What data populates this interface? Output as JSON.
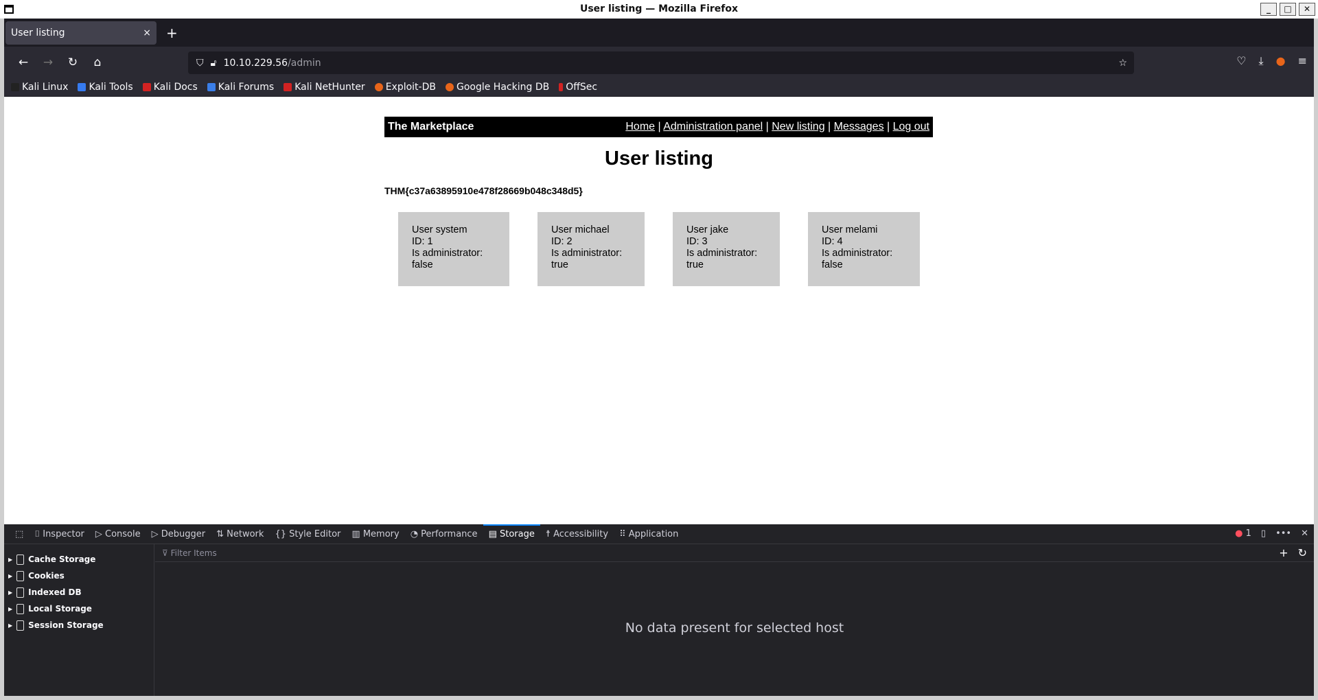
{
  "window": {
    "title": "User listing — Mozilla Firefox"
  },
  "tab": {
    "label": "User listing",
    "close": "×",
    "new": "+"
  },
  "url": {
    "host": "10.10.229.56",
    "path": "/admin"
  },
  "bookmarks": [
    {
      "label": "Kali Linux",
      "color": "#222222"
    },
    {
      "label": "Kali Tools",
      "color": "#367bf0"
    },
    {
      "label": "Kali Docs",
      "color": "#d22222"
    },
    {
      "label": "Kali Forums",
      "color": "#3a7ee8"
    },
    {
      "label": "Kali NetHunter",
      "color": "#d22222"
    },
    {
      "label": "Exploit-DB",
      "color": "#e8651a"
    },
    {
      "label": "Google Hacking DB",
      "color": "#e8651a"
    },
    {
      "label": "OffSec",
      "color": "#d22222"
    }
  ],
  "site": {
    "brand": "The Marketplace",
    "nav": [
      "Home",
      "Administration panel",
      "New listing",
      "Messages",
      "Log out"
    ],
    "heading": "User listing",
    "flag": "THM{c37a63895910e478f28669b048c348d5}",
    "users": [
      {
        "name": "User system",
        "id": "ID: 1",
        "admin_label": "Is administrator:",
        "admin": "false"
      },
      {
        "name": "User michael",
        "id": "ID: 2",
        "admin_label": "Is administrator:",
        "admin": "true"
      },
      {
        "name": "User jake",
        "id": "ID: 3",
        "admin_label": "Is administrator:",
        "admin": "true"
      },
      {
        "name": "User melami",
        "id": "ID: 4",
        "admin_label": "Is administrator:",
        "admin": "false"
      }
    ]
  },
  "devtools": {
    "tabs": [
      "Inspector",
      "Console",
      "Debugger",
      "Network",
      "Style Editor",
      "Memory",
      "Performance",
      "Storage",
      "Accessibility",
      "Application"
    ],
    "error_count": "1",
    "storage_items": [
      "Cache Storage",
      "Cookies",
      "Indexed DB",
      "Local Storage",
      "Session Storage"
    ],
    "filter_placeholder": "Filter Items",
    "empty_message": "No data present for selected host"
  }
}
